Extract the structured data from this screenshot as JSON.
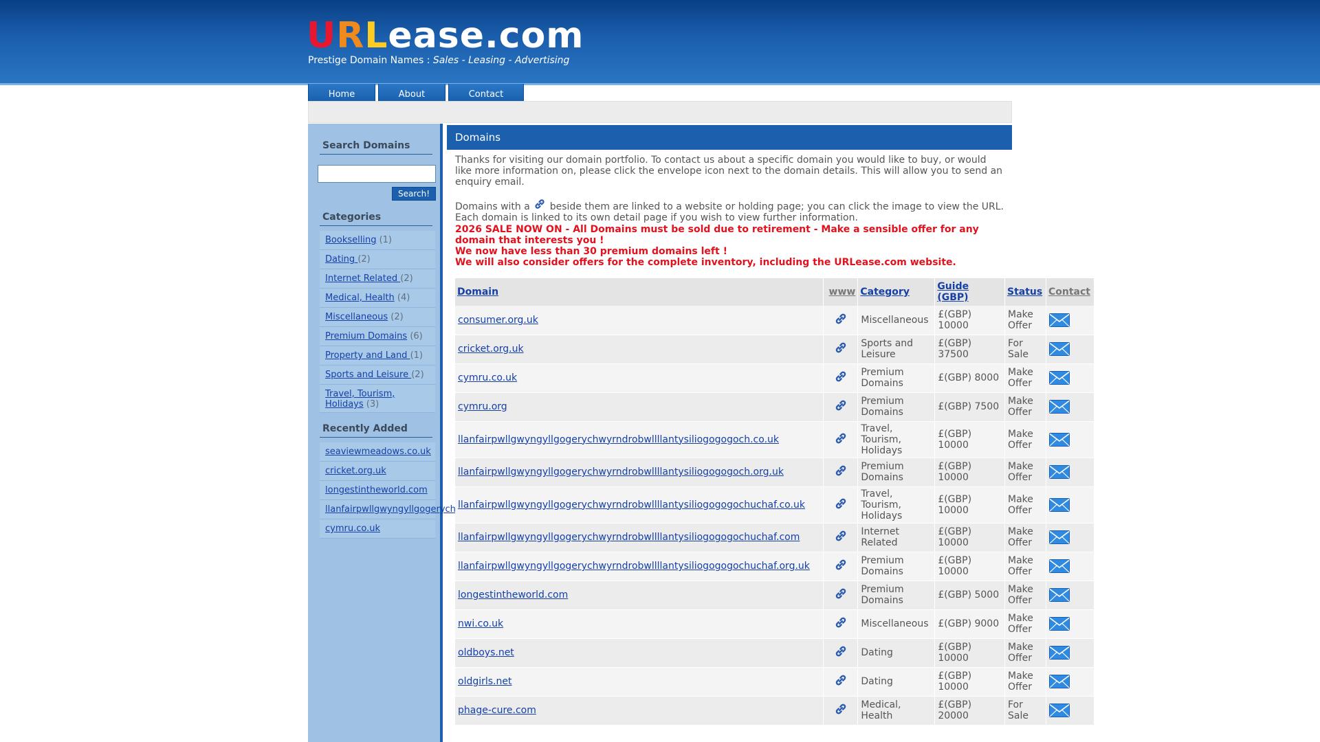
{
  "header": {
    "logo_u": "U",
    "logo_r": "R",
    "logo_l": "L",
    "logo_rest": "ease.com",
    "tagline_prefix": "Prestige Domain Names : ",
    "tagline_em": "Sales - Leasing - Advertising"
  },
  "nav": {
    "home": "Home",
    "about": "About",
    "contact": "Contact"
  },
  "sidebar": {
    "search_title": "Search Domains",
    "search_button": "Search!",
    "categories_title": "Categories",
    "categories": [
      {
        "label": "Bookselling",
        "count": "(1)"
      },
      {
        "label": "Dating ",
        "count": "(2)"
      },
      {
        "label": "Internet Related ",
        "count": "(2)"
      },
      {
        "label": "Medical, Health",
        "count": "(4)"
      },
      {
        "label": "Miscellaneous",
        "count": "(2)"
      },
      {
        "label": "Premium Domains",
        "count": "(6)"
      },
      {
        "label": "Property and Land ",
        "count": "(1)"
      },
      {
        "label": "Sports and Leisure ",
        "count": "(2)"
      },
      {
        "label": "Travel, Tourism, Holidays",
        "count": "(3)"
      }
    ],
    "recent_title": "Recently Added",
    "recent": [
      "seaviewmeadows.co.uk",
      "cricket.org.uk",
      "longestintheworld.com",
      "llanfairpwllgwyngyllgogerych...",
      "cymru.co.uk"
    ]
  },
  "main": {
    "title": "Domains",
    "intro1": "Thanks for visiting our domain portfolio. To contact us about a specific domain you would like to buy, or would like more information on, please click the envelope icon next to the domain details. This will allow you to send an enquiry email.",
    "intro2_pre": "Domains with a ",
    "intro2_post": " beside them are linked to a website or holding page; you can click the image to view the URL. Each domain is linked to its own detail page if you wish to view further information.",
    "sale1": "2026 SALE NOW ON - All Domains must be sold due to retirement - Make a sensible offer for any domain that interests you !",
    "sale2": "We now have less than 30 premium domains left !",
    "sale3": "We will also consider offers for the complete inventory, including the URLease.com website."
  },
  "table": {
    "headers": {
      "domain": "Domain",
      "www": "www",
      "category": "Category",
      "guide": "Guide (GBP)",
      "status": "Status",
      "contact": "Contact"
    },
    "rows": [
      {
        "domain": "consumer.org.uk",
        "category": "Miscellaneous",
        "guide": "£(GBP) 10000",
        "status": "Make Offer"
      },
      {
        "domain": "cricket.org.uk",
        "category": "Sports and Leisure",
        "guide": "£(GBP) 37500",
        "status": "For Sale"
      },
      {
        "domain": "cymru.co.uk",
        "category": "Premium Domains",
        "guide": "£(GBP) 8000",
        "status": "Make Offer"
      },
      {
        "domain": "cymru.org",
        "category": "Premium Domains",
        "guide": "£(GBP) 7500",
        "status": "Make Offer"
      },
      {
        "domain": "llanfairpwllgwyngyllgogerychwyrndrobwllllantysiliogogogoch.co.uk",
        "category": "Travel, Tourism, Holidays",
        "guide": "£(GBP) 10000",
        "status": "Make Offer"
      },
      {
        "domain": "llanfairpwllgwyngyllgogerychwyrndrobwllllantysiliogogogoch.org.uk",
        "category": "Premium Domains",
        "guide": "£(GBP) 10000",
        "status": "Make Offer"
      },
      {
        "domain": "llanfairpwllgwyngyllgogerychwyrndrobwllllantysiliogogogochuchaf.co.uk",
        "category": "Travel, Tourism, Holidays",
        "guide": "£(GBP) 10000",
        "status": "Make Offer"
      },
      {
        "domain": "llanfairpwllgwyngyllgogerychwyrndrobwllllantysiliogogogochuchaf.com",
        "category": "Internet Related",
        "guide": "£(GBP) 10000",
        "status": "Make Offer"
      },
      {
        "domain": "llanfairpwllgwyngyllgogerychwyrndrobwllllantysiliogogogochuchaf.org.uk",
        "category": "Premium Domains",
        "guide": "£(GBP) 10000",
        "status": "Make Offer"
      },
      {
        "domain": "longestintheworld.com",
        "category": "Premium Domains",
        "guide": "£(GBP) 5000",
        "status": "Make Offer"
      },
      {
        "domain": "nwi.co.uk",
        "category": "Miscellaneous",
        "guide": "£(GBP) 9000",
        "status": "Make Offer"
      },
      {
        "domain": "oldboys.net",
        "category": "Dating",
        "guide": "£(GBP) 10000",
        "status": "Make Offer"
      },
      {
        "domain": "oldgirls.net",
        "category": "Dating",
        "guide": "£(GBP) 10000",
        "status": "Make Offer"
      },
      {
        "domain": "phage-cure.com",
        "category": "Medical, Health",
        "guide": "£(GBP) 20000",
        "status": "For Sale"
      }
    ]
  },
  "colors": {
    "header_blue": "#1b5fad",
    "sidebar_blue": "#9ec1e4",
    "sale_red": "#e0121d",
    "link_blue": "#1540a8"
  },
  "icons": {
    "www": "chain-link-icon",
    "contact": "envelope-icon"
  }
}
